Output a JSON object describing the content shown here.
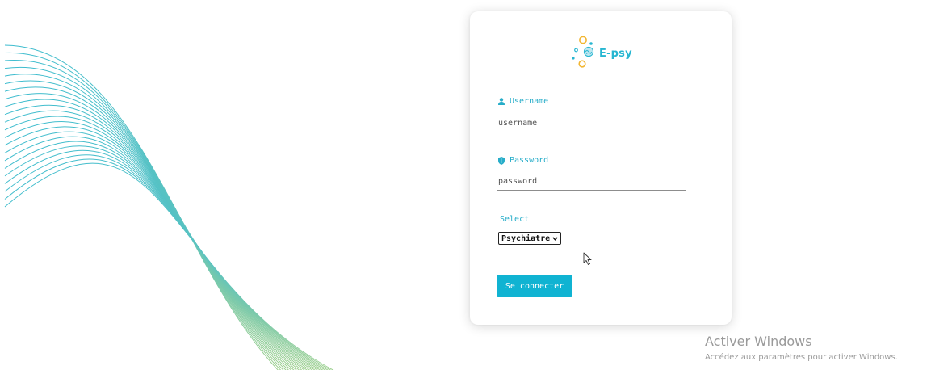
{
  "brand": {
    "name": "E-psy",
    "color": "#26b6d1",
    "accent": "#f2b632"
  },
  "form": {
    "username": {
      "label": "Username",
      "icon": "user-icon",
      "placeholder": "username",
      "value": ""
    },
    "password": {
      "label": "Password",
      "icon": "shield-icon",
      "placeholder": "password",
      "value": ""
    },
    "select": {
      "label": "Select",
      "selected": "Psychiatre",
      "icon": "chevron-down-icon"
    },
    "submit_label": "Se connecter",
    "button_color": "#10b3d2"
  },
  "background": {
    "decoration": "wave-lines",
    "colors": [
      "#3dbccf",
      "#9fd08c"
    ]
  },
  "watermark": {
    "title": "Activer Windows",
    "subtitle": "Accédez aux paramètres pour activer Windows."
  }
}
